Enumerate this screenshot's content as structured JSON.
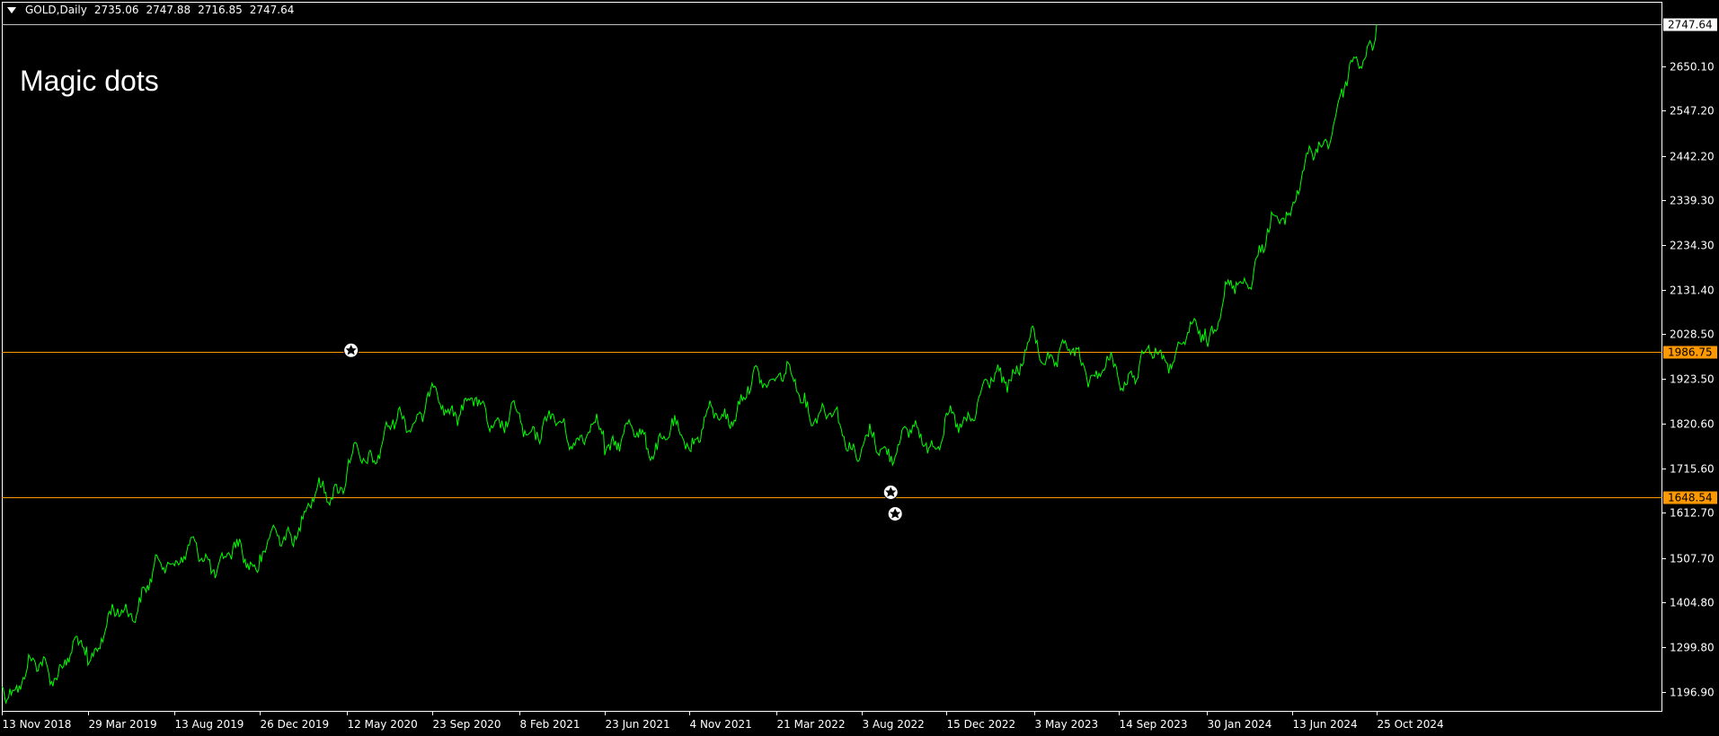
{
  "header": {
    "symbol": "GOLD,Daily",
    "open": "2735.06",
    "high": "2747.88",
    "low": "2716.85",
    "close": "2747.64"
  },
  "overlay_title": "Magic dots",
  "colors": {
    "background": "#000000",
    "frame": "#ffffff",
    "price": "#00ff00",
    "level": "#ff9900",
    "last_price_line": "#c0c0c0"
  },
  "chart_data": {
    "type": "line",
    "ylim": [
      1150,
      2800
    ],
    "y_ticks": [
      2650.1,
      2547.2,
      2442.2,
      2339.3,
      2234.3,
      2131.4,
      2028.5,
      1923.5,
      1820.6,
      1715.6,
      1612.7,
      1507.7,
      1404.8,
      1299.8,
      1196.9
    ],
    "x_tick_labels": [
      "13 Nov 2018",
      "29 Mar 2019",
      "13 Aug 2019",
      "26 Dec 2019",
      "12 May 2020",
      "23 Sep 2020",
      "8 Feb 2021",
      "23 Jun 2021",
      "4 Nov 2021",
      "21 Mar 2022",
      "3 Aug 2022",
      "15 Dec 2022",
      "3 May 2023",
      "14 Sep 2023",
      "30 Jan 2024",
      "13 Jun 2024",
      "25 Oct 2024"
    ],
    "series": [
      {
        "points": [
          [
            "13 Nov 2018",
            1212
          ],
          [
            "29 Mar 2019",
            1290
          ],
          [
            "13 Aug 2019",
            1510
          ],
          [
            "26 Dec 2019",
            1505
          ],
          [
            "12 May 2020",
            1710
          ],
          [
            "23 Sep 2020",
            1880
          ],
          [
            "8 Feb 2021",
            1820
          ],
          [
            "23 Jun 2021",
            1790
          ],
          [
            "4 Nov 2021",
            1780
          ],
          [
            "21 Mar 2022",
            1940
          ],
          [
            "3 Aug 2022",
            1760
          ],
          [
            "15 Dec 2022",
            1800
          ],
          [
            "3 May 2023",
            2000
          ],
          [
            "14 Sep 2023",
            1930
          ],
          [
            "30 Jan 2024",
            2030
          ],
          [
            "13 Jun 2024",
            2330
          ],
          [
            "25 Oct 2024",
            2747.64
          ]
        ]
      }
    ],
    "levels": [
      {
        "value": 1986.75,
        "label": "1986.75"
      },
      {
        "value": 1648.54,
        "label": "1648.54"
      }
    ],
    "last_price": {
      "value": 2747.64,
      "label": "2747.64"
    },
    "markers": [
      {
        "date": "12 May 2020",
        "offset_days": 6,
        "value": 1990
      },
      {
        "date": "3 Aug 2022",
        "offset_days": 46,
        "value": 1660
      },
      {
        "date": "3 Aug 2022",
        "offset_days": 53,
        "value": 1610
      }
    ]
  }
}
